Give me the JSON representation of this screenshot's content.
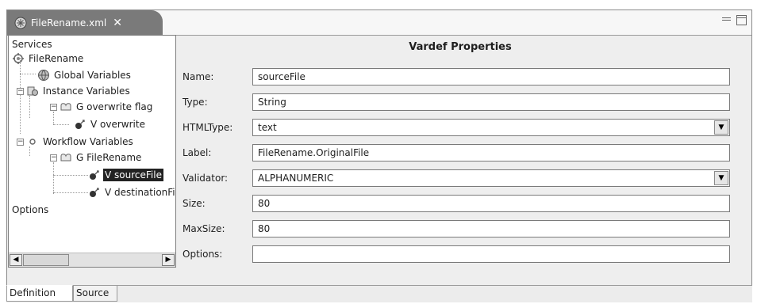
{
  "editor": {
    "tab_title": "FileRename.xml",
    "tab_close": "✕"
  },
  "tree": {
    "root_label": "Services",
    "nodes": [
      {
        "label": "FileRename",
        "icon": "service-icon"
      },
      {
        "label": "Global Variables",
        "icon": "globe-icon"
      },
      {
        "label": "Instance Variables",
        "icon": "variables-group-icon",
        "expanded": true
      },
      {
        "label": "G overwrite flag",
        "icon": "group-icon",
        "expanded": true
      },
      {
        "label": "V overwrite",
        "icon": "variable-icon"
      },
      {
        "label": "Workflow Variables",
        "icon": "workflow-icon",
        "expanded": true
      },
      {
        "label": "G FileRename",
        "icon": "group-icon",
        "expanded": true
      },
      {
        "label": "V sourceFile",
        "icon": "variable-icon",
        "selected": true
      },
      {
        "label": "V destinationFile",
        "icon": "variable-icon"
      }
    ],
    "options_label": "Options"
  },
  "properties": {
    "title": "Vardef Properties",
    "fields": [
      {
        "label": "Name:",
        "value": "sourceFile",
        "type": "text"
      },
      {
        "label": "Type:",
        "value": "String",
        "type": "text"
      },
      {
        "label": "HTMLType:",
        "value": "text",
        "type": "select"
      },
      {
        "label": "Label:",
        "value": "FileRename.OriginalFile",
        "type": "text"
      },
      {
        "label": "Validator:",
        "value": "ALPHANUMERIC",
        "type": "select"
      },
      {
        "label": "Size:",
        "value": "80",
        "type": "text"
      },
      {
        "label": "MaxSize:",
        "value": "80",
        "type": "text"
      },
      {
        "label": "Options:",
        "value": "",
        "type": "text"
      }
    ]
  },
  "bottom_tabs": [
    {
      "label": "Definition",
      "active": true
    },
    {
      "label": "Source",
      "active": false
    }
  ],
  "colors": {
    "selection": "#222222",
    "tab_active": "#7a7a7a"
  }
}
